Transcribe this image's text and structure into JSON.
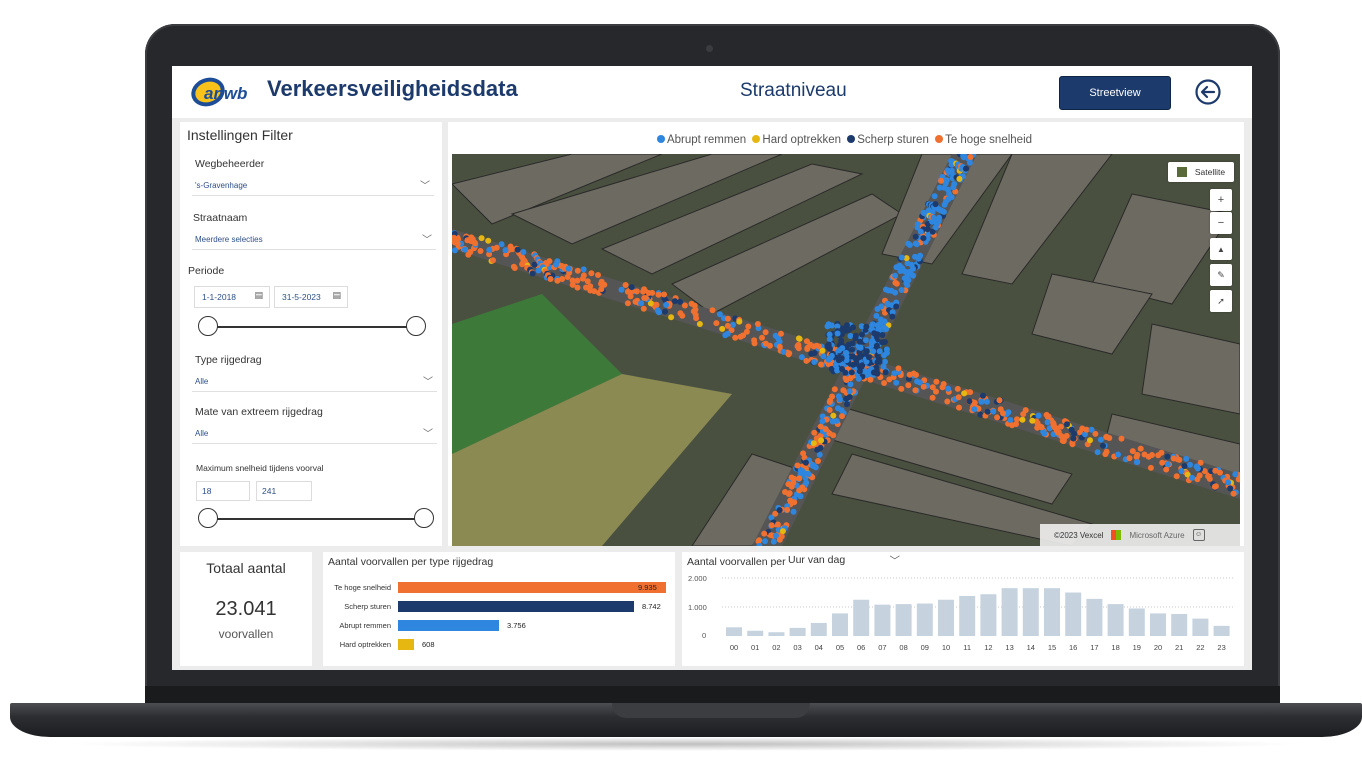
{
  "header": {
    "logo_text": "anwb",
    "app_title": "Verkeersveiligheidsdata",
    "page_title": "Straatniveau",
    "streetview_label": "Streetview"
  },
  "filter": {
    "title": "Instellingen Filter",
    "wegbeheerder_label": "Wegbeheerder",
    "wegbeheerder_value": "'s-Gravenhage",
    "straatnaam_label": "Straatnaam",
    "straatnaam_value": "Meerdere selecties",
    "periode_label": "Periode",
    "periode_start": "1-1-2018",
    "periode_end": "31-5-2023",
    "type_label": "Type rijgedrag",
    "type_value": "Alle",
    "mate_label": "Mate van extreem rijgedrag",
    "mate_value": "Alle",
    "snelheid_label": "Maximum snelheid tijdens voorval",
    "snelheid_min": "18",
    "snelheid_max": "241"
  },
  "map": {
    "legend": [
      {
        "label": "Abrupt remmen",
        "color": "#2e86de"
      },
      {
        "label": "Hard optrekken",
        "color": "#e5b710"
      },
      {
        "label": "Scherp sturen",
        "color": "#1c3a6b"
      },
      {
        "label": "Te hoge snelheid",
        "color": "#f07030"
      }
    ],
    "satellite_label": "Satellite",
    "attribution": "©2023 Vexcel",
    "provider": "Microsoft Azure"
  },
  "totals": {
    "title": "Totaal aantal",
    "value": "23.041",
    "unit": "voorvallen"
  },
  "type_chart": {
    "title": "Aantal voorvallen per type rijgedrag",
    "bars": [
      {
        "label": "Te hoge snelheid",
        "value": 9935,
        "display": "9.935",
        "color": "#f07030"
      },
      {
        "label": "Scherp sturen",
        "value": 8742,
        "display": "8.742",
        "color": "#1c3a6b"
      },
      {
        "label": "Abrupt remmen",
        "value": 3756,
        "display": "3.756",
        "color": "#2e86de"
      },
      {
        "label": "Hard optrekken",
        "value": 608,
        "display": "608",
        "color": "#e5b710"
      }
    ]
  },
  "hour_chart": {
    "title": "Aantal voorvallen per",
    "dropdown": "Uur van dag",
    "ytick_labels": [
      "2.000",
      "1.000",
      "0"
    ]
  },
  "chart_data": [
    {
      "type": "bar",
      "title": "Aantal voorvallen per type rijgedrag",
      "categories": [
        "Te hoge snelheid",
        "Scherp sturen",
        "Abrupt remmen",
        "Hard optrekken"
      ],
      "values": [
        9935,
        8742,
        3756,
        608
      ]
    },
    {
      "type": "bar",
      "title": "Aantal voorvallen per Uur van dag",
      "categories": [
        "00",
        "01",
        "02",
        "03",
        "04",
        "05",
        "06",
        "07",
        "08",
        "09",
        "10",
        "11",
        "12",
        "13",
        "14",
        "15",
        "16",
        "17",
        "18",
        "19",
        "20",
        "21",
        "22",
        "23"
      ],
      "values": [
        300,
        180,
        130,
        280,
        450,
        780,
        1250,
        1080,
        1100,
        1120,
        1250,
        1380,
        1440,
        1650,
        1650,
        1650,
        1500,
        1280,
        1100,
        950,
        780,
        760,
        600,
        350
      ],
      "ylim": [
        0,
        2000
      ],
      "grid": true
    }
  ]
}
